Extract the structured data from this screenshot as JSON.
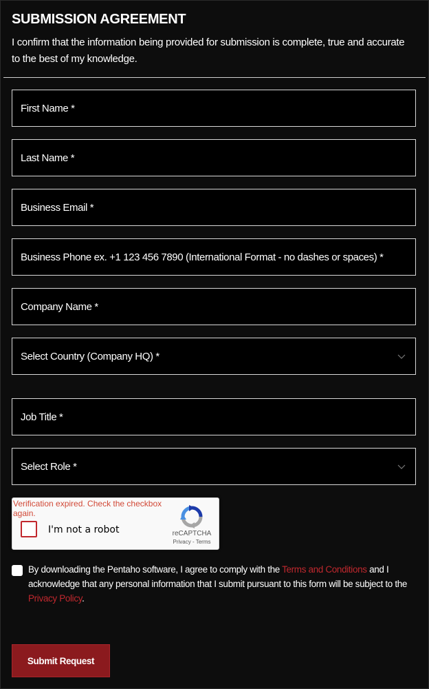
{
  "agreement": {
    "heading": "SUBMISSION AGREEMENT",
    "text": "I confirm that the information being provided for submission is complete, true and accurate to the best of my knowledge."
  },
  "form": {
    "first_name": {
      "placeholder": "First Name *",
      "value": ""
    },
    "last_name": {
      "placeholder": "Last Name *",
      "value": ""
    },
    "business_email": {
      "placeholder": "Business Email *",
      "value": ""
    },
    "business_phone": {
      "placeholder": "Business Phone ex. +1 123 456 7890 (International Format - no dashes or spaces) *",
      "value": ""
    },
    "company_name": {
      "placeholder": "Company Name *",
      "value": ""
    },
    "country": {
      "selected": "Select Country (Company HQ) *"
    },
    "job_title": {
      "placeholder": "Job Title *",
      "value": ""
    },
    "role": {
      "selected": "Select Role *"
    }
  },
  "recaptcha": {
    "error": "Verification expired. Check the checkbox again.",
    "label": "I'm not a robot",
    "brand": "reCAPTCHA",
    "privacy": "Privacy",
    "separator": " - ",
    "terms": "Terms"
  },
  "consent": {
    "text_before": "By downloading the Pentaho software, I agree to comply with the ",
    "terms_link": "Terms and Conditions",
    "text_middle": " and I acknowledge that any personal information that I submit pursuant to this form will be subject to the ",
    "privacy_link": "Privacy Policy",
    "text_after": "."
  },
  "submit": {
    "label": "Submit Request"
  },
  "colors": {
    "background": "#0d0d0d",
    "field_background": "#000000",
    "field_border": "#d9d9d9",
    "accent_link": "#c0282e",
    "submit_background": "#8b1a1e",
    "recaptcha_error": "#d14836"
  },
  "icons": {
    "dropdown": "chevron-down-icon",
    "recaptcha": "recaptcha-logo-icon"
  }
}
